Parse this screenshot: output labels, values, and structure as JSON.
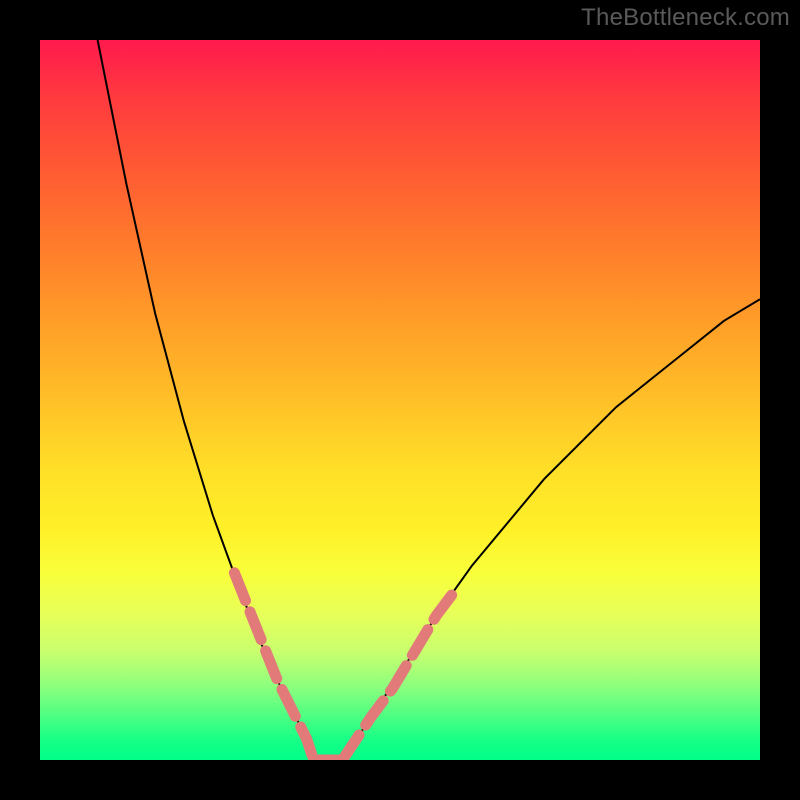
{
  "watermark": "TheBottleneck.com",
  "chart_data": {
    "type": "line",
    "title": "",
    "xlabel": "",
    "ylabel": "",
    "xlim": [
      0,
      100
    ],
    "ylim": [
      0,
      100
    ],
    "grid": false,
    "legend": false,
    "series": [
      {
        "name": "curve-left",
        "stroke": "#000000",
        "stroke_width": 2,
        "x": [
          8,
          12,
          16,
          20,
          24,
          28,
          30,
          32,
          34,
          36,
          37,
          38
        ],
        "y": [
          100,
          80,
          62,
          47,
          34,
          23,
          18,
          13,
          9,
          5,
          3,
          0
        ]
      },
      {
        "name": "curve-right",
        "stroke": "#000000",
        "stroke_width": 2,
        "x": [
          42,
          44,
          46,
          50,
          55,
          60,
          65,
          70,
          75,
          80,
          85,
          90,
          95,
          100
        ],
        "y": [
          0,
          3,
          6,
          12,
          20,
          27,
          33,
          39,
          44,
          49,
          53,
          57,
          61,
          64
        ]
      },
      {
        "name": "highlight-left",
        "stroke": "#e27a7a",
        "stroke_width": 11,
        "linecap": "round",
        "dash": "30 12",
        "x": [
          27,
          29,
          31,
          33,
          35,
          37,
          38
        ],
        "y": [
          26,
          21,
          16,
          11,
          7,
          3,
          0
        ]
      },
      {
        "name": "highlight-floor",
        "stroke": "#e27a7a",
        "stroke_width": 11,
        "linecap": "round",
        "dash": "30 12",
        "x": [
          38,
          42
        ],
        "y": [
          0,
          0
        ]
      },
      {
        "name": "highlight-right",
        "stroke": "#e27a7a",
        "stroke_width": 11,
        "linecap": "round",
        "dash": "30 12",
        "x": [
          42,
          44,
          46,
          49,
          52,
          55,
          58
        ],
        "y": [
          0,
          3,
          6,
          10,
          15,
          20,
          24
        ]
      }
    ]
  }
}
